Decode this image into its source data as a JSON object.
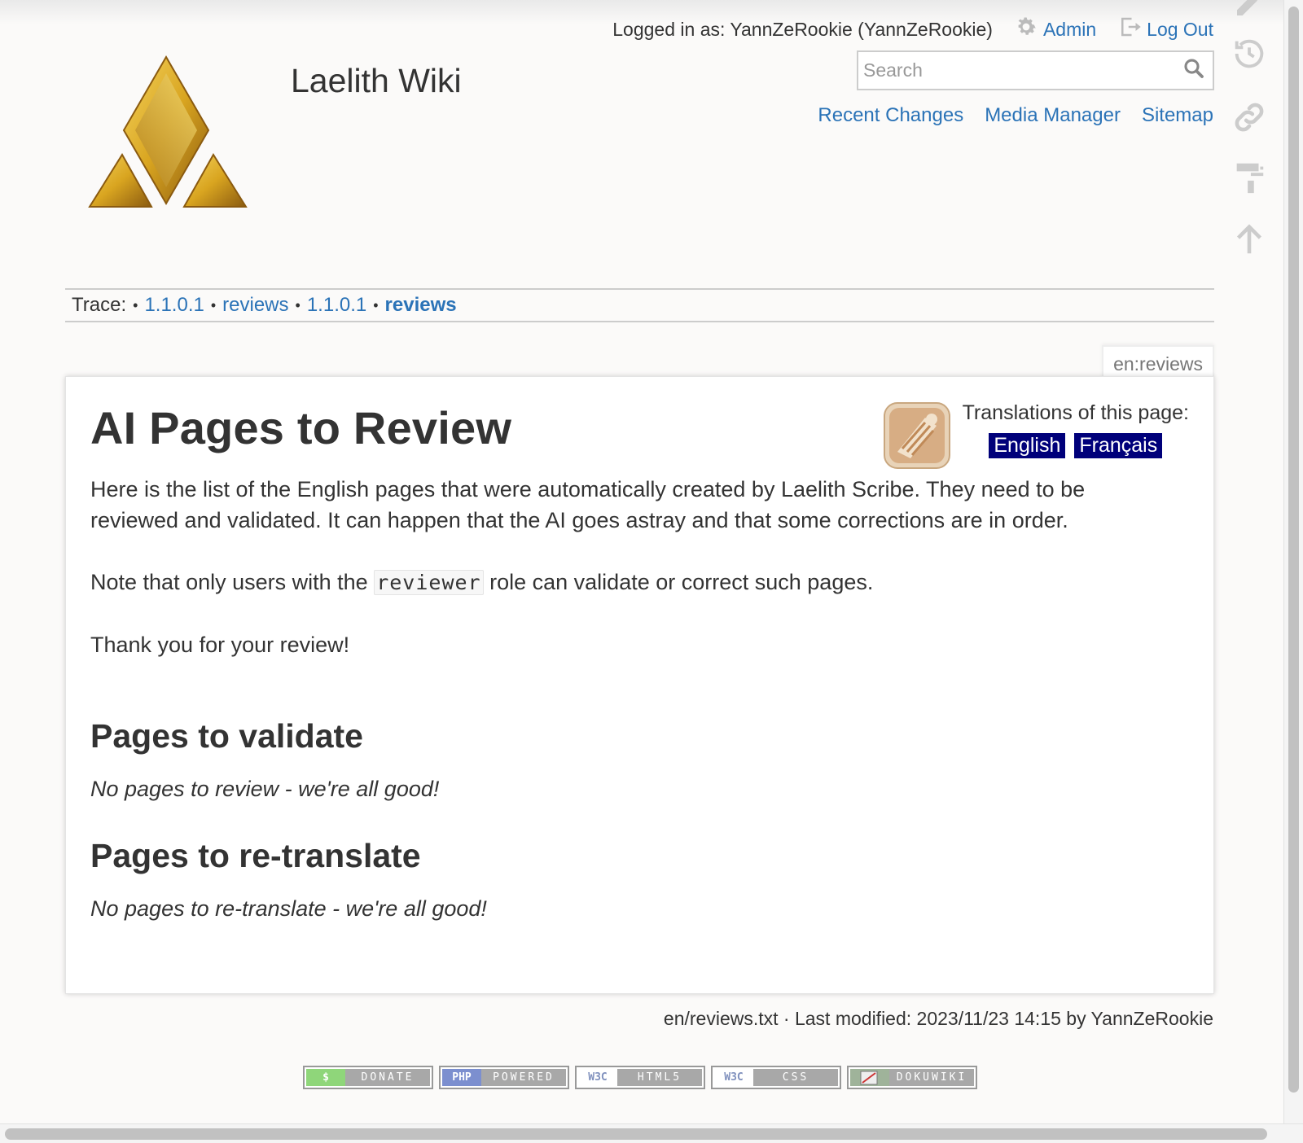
{
  "header": {
    "logged_in_text": "Logged in as: YannZeRookie (YannZeRookie)",
    "admin_label": "Admin",
    "logout_label": "Log Out",
    "site_title": "Laelith Wiki",
    "search_placeholder": "Search",
    "site_tools": {
      "recent_changes": "Recent Changes",
      "media_manager": "Media Manager",
      "sitemap": "Sitemap"
    }
  },
  "breadcrumb": {
    "label": "Trace:",
    "separator": "•",
    "items": [
      "1.1.0.1",
      "reviews",
      "1.1.0.1",
      "reviews"
    ]
  },
  "page_id": "en:reviews",
  "content": {
    "title": "AI Pages to Review",
    "intro": "Here is the list of the English pages that were automatically created by Laelith Scribe. They need to be reviewed and validated. It can happen that the AI goes astray and that some corrections are in order.",
    "note_before": "Note that only users with the ",
    "note_code": "reviewer",
    "note_after": " role can validate or correct such pages.",
    "thanks": "Thank you for your review!",
    "section1_title": "Pages to validate",
    "section1_empty": "No pages to review - we're all good!",
    "section2_title": "Pages to re-translate",
    "section2_empty": "No pages to re-translate - we're all good!"
  },
  "translations": {
    "label": "Translations of this page:",
    "languages": [
      "English",
      "Français"
    ]
  },
  "footer": {
    "doc_info": "en/reviews.txt · Last modified: 2023/11/23 14:15 by YannZeRookie",
    "badges": [
      {
        "left": "$",
        "right": "DONATE",
        "color": "#8fd67a"
      },
      {
        "left": "PHP",
        "right": "POWERED",
        "color": "#7c8fcf"
      },
      {
        "left": "W3C",
        "right": "HTML5",
        "color": "#c8d0e6"
      },
      {
        "left": "W3C",
        "right": "CSS",
        "color": "#c8d0e6"
      },
      {
        "left": "DW",
        "right": "DOKUWIKI",
        "color": "#9fb39a"
      }
    ]
  },
  "colors": {
    "link": "#2b73b7",
    "lang_badge": "#00007a",
    "logo_gold": "#d9a520"
  }
}
